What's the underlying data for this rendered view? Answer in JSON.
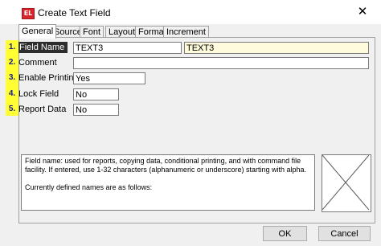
{
  "window": {
    "app_icon_text": "EL",
    "title": "Create Text Field",
    "close_glyph": "✕"
  },
  "tabs": [
    {
      "label": "General",
      "active": true
    },
    {
      "label": "Source",
      "active": false
    },
    {
      "label": "Font",
      "active": false
    },
    {
      "label": "Layout",
      "active": false
    },
    {
      "label": "Format",
      "active": false
    },
    {
      "label": "Increment",
      "active": false
    }
  ],
  "badges": [
    "1.",
    "2.",
    "3.",
    "4.",
    "5."
  ],
  "badge_color": "#ffff33",
  "fields": {
    "field_name": {
      "label": "Field Name",
      "value": "TEXT3",
      "preview": "TEXT3"
    },
    "comment": {
      "label": "Comment",
      "value": ""
    },
    "enable_printing": {
      "label": "Enable Printing",
      "value": "Yes"
    },
    "lock_field": {
      "label": "Lock Field",
      "value": "No"
    },
    "report_data": {
      "label": "Report Data",
      "value": "No"
    }
  },
  "help": {
    "line1": "Field name: used for reports, copying data, conditional printing, and with command file facility. If entered, use 1-32 characters (alphanumeric or underscore) starting with alpha.",
    "line2": "Currently defined names are as follows:"
  },
  "buttons": {
    "ok": "OK",
    "cancel": "Cancel"
  }
}
